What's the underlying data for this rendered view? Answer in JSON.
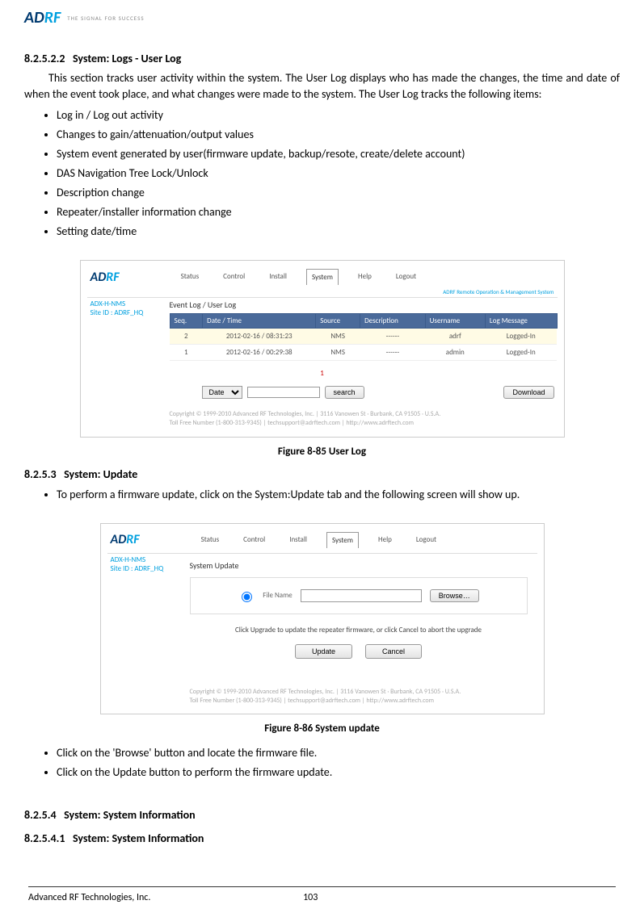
{
  "header": {
    "logo_seg1": "AD",
    "logo_seg2": "RF",
    "tagline": "THE SIGNAL FOR SUCCESS"
  },
  "doc": {
    "h1_num": "8.2.5.2.2",
    "h1_title": "System: Logs - User Log",
    "p1": "This section tracks user activity within the system.  The User Log displays who has made the changes, the time and date of when the event took place, and what changes were made to the system. The User Log tracks the following items:",
    "bullets1": [
      "Log in / Log out activity",
      "Changes to gain/attenuation/output values",
      "System event generated by user(firmware update, backup/resote, create/delete account)",
      "DAS Navigation Tree Lock/Unlock",
      "Description change",
      "Repeater/installer information change",
      "Setting date/time"
    ],
    "fig1_caption": "Figure 8-85    User Log",
    "h2_num": "8.2.5.3",
    "h2_title": "System: Update",
    "bullets2": [
      "To perform a firmware update, click on the System:Update tab and the following screen will show up."
    ],
    "fig2_caption": "Figure 8-86    System update",
    "bullets3": [
      "Click on the 'Browse' button and locate the firmware file.",
      "Click on the Update button to perform the firmware update."
    ],
    "h3_num": "8.2.5.4",
    "h3_title": "System: System Information",
    "h4_num": "8.2.5.4.1",
    "h4_title": "System: System Information"
  },
  "shot1": {
    "nav": [
      "Status",
      "Control",
      "Install",
      "System",
      "Help",
      "Logout"
    ],
    "active_nav": "System",
    "roms": "ADRF Remote Operation & Management System",
    "side1": "ADX-H-NMS",
    "side2": "Site ID : ADRF_HQ",
    "breadcrumb": "Event Log / User Log",
    "thead": [
      "Seq.",
      "Date / Time",
      "Source",
      "Description",
      "Username",
      "Log Message"
    ],
    "rows": [
      {
        "seq": "2",
        "dt": "2012-02-16 / 08:31:23",
        "src": "NMS",
        "desc": "------",
        "user": "adrf",
        "msg": "Logged-In"
      },
      {
        "seq": "1",
        "dt": "2012-02-16 / 00:29:38",
        "src": "NMS",
        "desc": "------",
        "user": "admin",
        "msg": "Logged-In"
      }
    ],
    "pager": "1",
    "search_select": "Date",
    "search_btn": "search",
    "download_btn": "Download",
    "footer1": "Copyright © 1999-2010 Advanced RF Technologies, Inc. | 3116 Vanowen St · Burbank, CA 91505 · U.S.A.",
    "footer2": "Toll Free Number (1-800-313-9345) | techsupport@adrftech.com | http://www.adrftech.com"
  },
  "shot2": {
    "nav": [
      "Status",
      "Control",
      "Install",
      "System",
      "Help",
      "Logout"
    ],
    "active_nav": "System",
    "side1": "ADX-H-NMS",
    "side2": "Site ID : ADRF_HQ",
    "heading": "System Update",
    "file_label": "File Name",
    "browse_btn": "Browse…",
    "note": "Click Upgrade to update the repeater firmware, or click Cancel to abort the upgrade",
    "update_btn": "Update",
    "cancel_btn": "Cancel",
    "footer1": "Copyright © 1999-2010 Advanced RF Technologies, Inc. | 3116 Vanowen St · Burbank, CA 91505 · U.S.A.",
    "footer2": "Toll Free Number (1-800-313-9345) | techsupport@adrftech.com | http://www.adrftech.com"
  },
  "footer": {
    "company": "Advanced RF Technologies, Inc.",
    "page": "103"
  }
}
